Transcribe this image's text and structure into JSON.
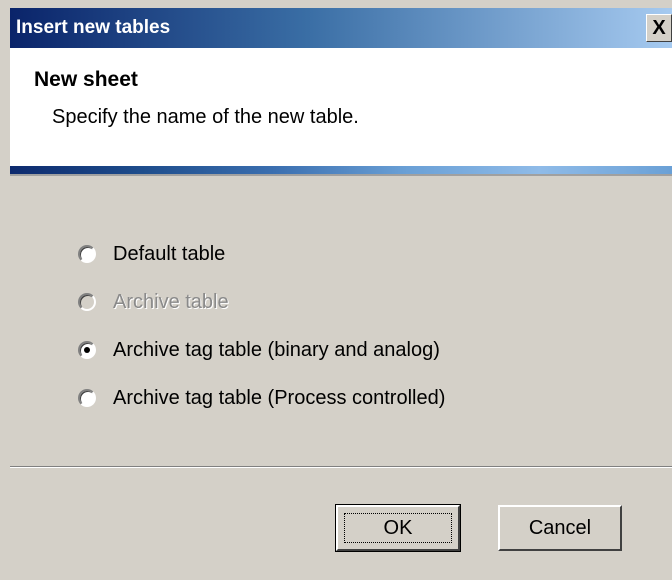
{
  "window": {
    "title": "Insert new tables",
    "close_glyph": "X"
  },
  "header": {
    "title": "New sheet",
    "subtitle": "Specify the name of the new table."
  },
  "options": [
    {
      "label": "Default table",
      "selected": false,
      "enabled": true
    },
    {
      "label": "Archive table",
      "selected": false,
      "enabled": false
    },
    {
      "label": "Archive tag table (binary and analog)",
      "selected": true,
      "enabled": true
    },
    {
      "label": "Archive tag table (Process controlled)",
      "selected": false,
      "enabled": true
    }
  ],
  "buttons": {
    "ok": "OK",
    "cancel": "Cancel"
  },
  "colors": {
    "titlebar_start": "#0a246a",
    "titlebar_end": "#a6caf0",
    "dialog_bg": "#d4d0c8"
  }
}
